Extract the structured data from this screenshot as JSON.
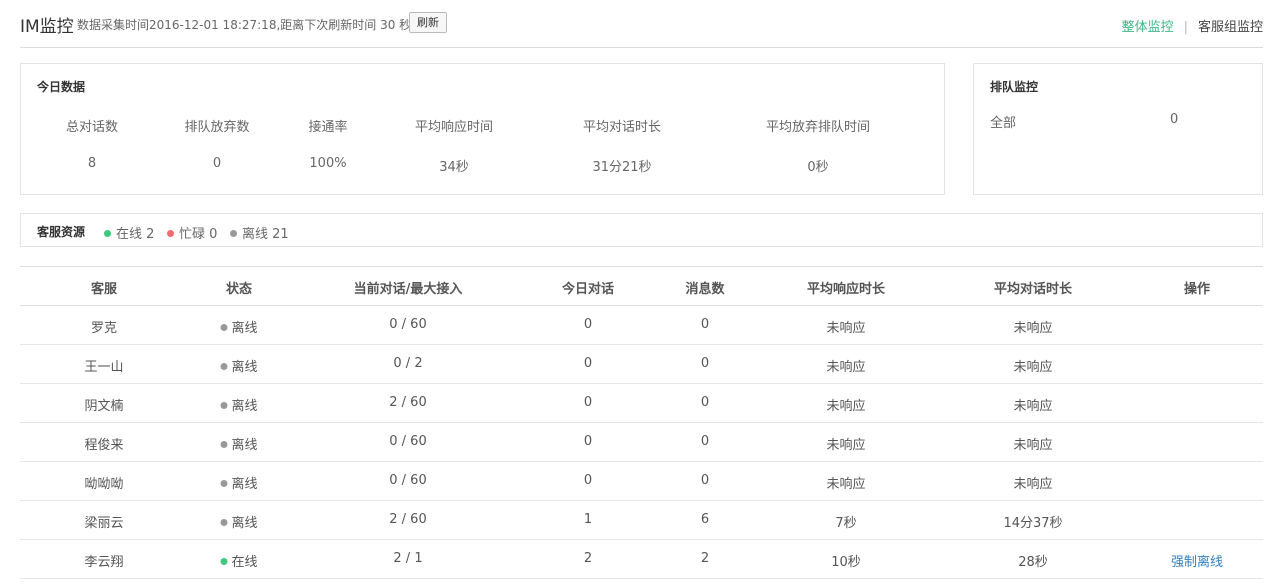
{
  "header": {
    "title": "IM监控",
    "info": "数据采集时间2016-12-01 18:27:18,距离下次刷新时间 30 秒",
    "refresh_label": "刷新",
    "link_overall": "整体监控",
    "link_separator": "|",
    "link_group": "客服组监控"
  },
  "today": {
    "title": "今日数据",
    "stats": [
      {
        "label": "总对话数",
        "value": "8"
      },
      {
        "label": "排队放弃数",
        "value": "0"
      },
      {
        "label": "接通率",
        "value": "100%"
      },
      {
        "label": "平均响应时间",
        "value": "34秒"
      },
      {
        "label": "平均对话时长",
        "value": "31分21秒"
      },
      {
        "label": "平均放弃排队时间",
        "value": "0秒"
      }
    ]
  },
  "queue": {
    "title": "排队监控",
    "name": "全部",
    "count": "0"
  },
  "resources": {
    "title": "客服资源",
    "online": "在线 2",
    "busy": "忙碌 0",
    "offline": "离线 21"
  },
  "colors": {
    "online": "#3ec97d",
    "busy": "#f26b6b",
    "offline": "#999999",
    "accent": "#3db786",
    "link": "#2e7fc0"
  },
  "table": {
    "headers": [
      "客服",
      "状态",
      "当前对话/最大接入",
      "今日对话",
      "消息数",
      "平均响应时长",
      "平均对话时长",
      "操作"
    ],
    "rows": [
      {
        "agent": "罗克",
        "status": "离线",
        "status_type": "offline",
        "sessions": "0 / 60",
        "today": "0",
        "messages": "0",
        "avg_response": "未响应",
        "avg_duration": "未响应",
        "action": ""
      },
      {
        "agent": "王一山",
        "status": "离线",
        "status_type": "offline",
        "sessions": "0 / 2",
        "today": "0",
        "messages": "0",
        "avg_response": "未响应",
        "avg_duration": "未响应",
        "action": ""
      },
      {
        "agent": "阴文楠",
        "status": "离线",
        "status_type": "offline",
        "sessions": "2 / 60",
        "today": "0",
        "messages": "0",
        "avg_response": "未响应",
        "avg_duration": "未响应",
        "action": ""
      },
      {
        "agent": "程俊来",
        "status": "离线",
        "status_type": "offline",
        "sessions": "0 / 60",
        "today": "0",
        "messages": "0",
        "avg_response": "未响应",
        "avg_duration": "未响应",
        "action": ""
      },
      {
        "agent": "呦呦呦",
        "status": "离线",
        "status_type": "offline",
        "sessions": "0 / 60",
        "today": "0",
        "messages": "0",
        "avg_response": "未响应",
        "avg_duration": "未响应",
        "action": ""
      },
      {
        "agent": "梁丽云",
        "status": "离线",
        "status_type": "offline",
        "sessions": "2 / 60",
        "today": "1",
        "messages": "6",
        "avg_response": "7秒",
        "avg_duration": "14分37秒",
        "action": ""
      },
      {
        "agent": "李云翔",
        "status": "在线",
        "status_type": "online",
        "sessions": "2 / 1",
        "today": "2",
        "messages": "2",
        "avg_response": "10秒",
        "avg_duration": "28秒",
        "action": "强制离线"
      }
    ]
  }
}
